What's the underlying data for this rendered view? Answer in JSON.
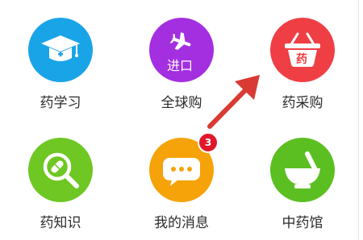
{
  "grid": {
    "items": [
      {
        "label": "药学习",
        "icon": "graduation-cap-icon",
        "color": "#1aa4e8"
      },
      {
        "label": "全球购",
        "icon": "airplane-icon",
        "color": "#a32fe0",
        "inner_text": "进口"
      },
      {
        "label": "药采购",
        "icon": "shopping-basket-icon",
        "color": "#ef3f44",
        "inner_text": "药"
      },
      {
        "label": "药知识",
        "icon": "magnifier-pill-icon",
        "color": "#6ec723"
      },
      {
        "label": "我的消息",
        "icon": "chat-bubble-icon",
        "color": "#f5a309",
        "badge": "3"
      },
      {
        "label": "中药馆",
        "icon": "mortar-icon",
        "color": "#5cbf21"
      }
    ]
  },
  "annotation": {
    "arrow_color": "#d93a34"
  }
}
